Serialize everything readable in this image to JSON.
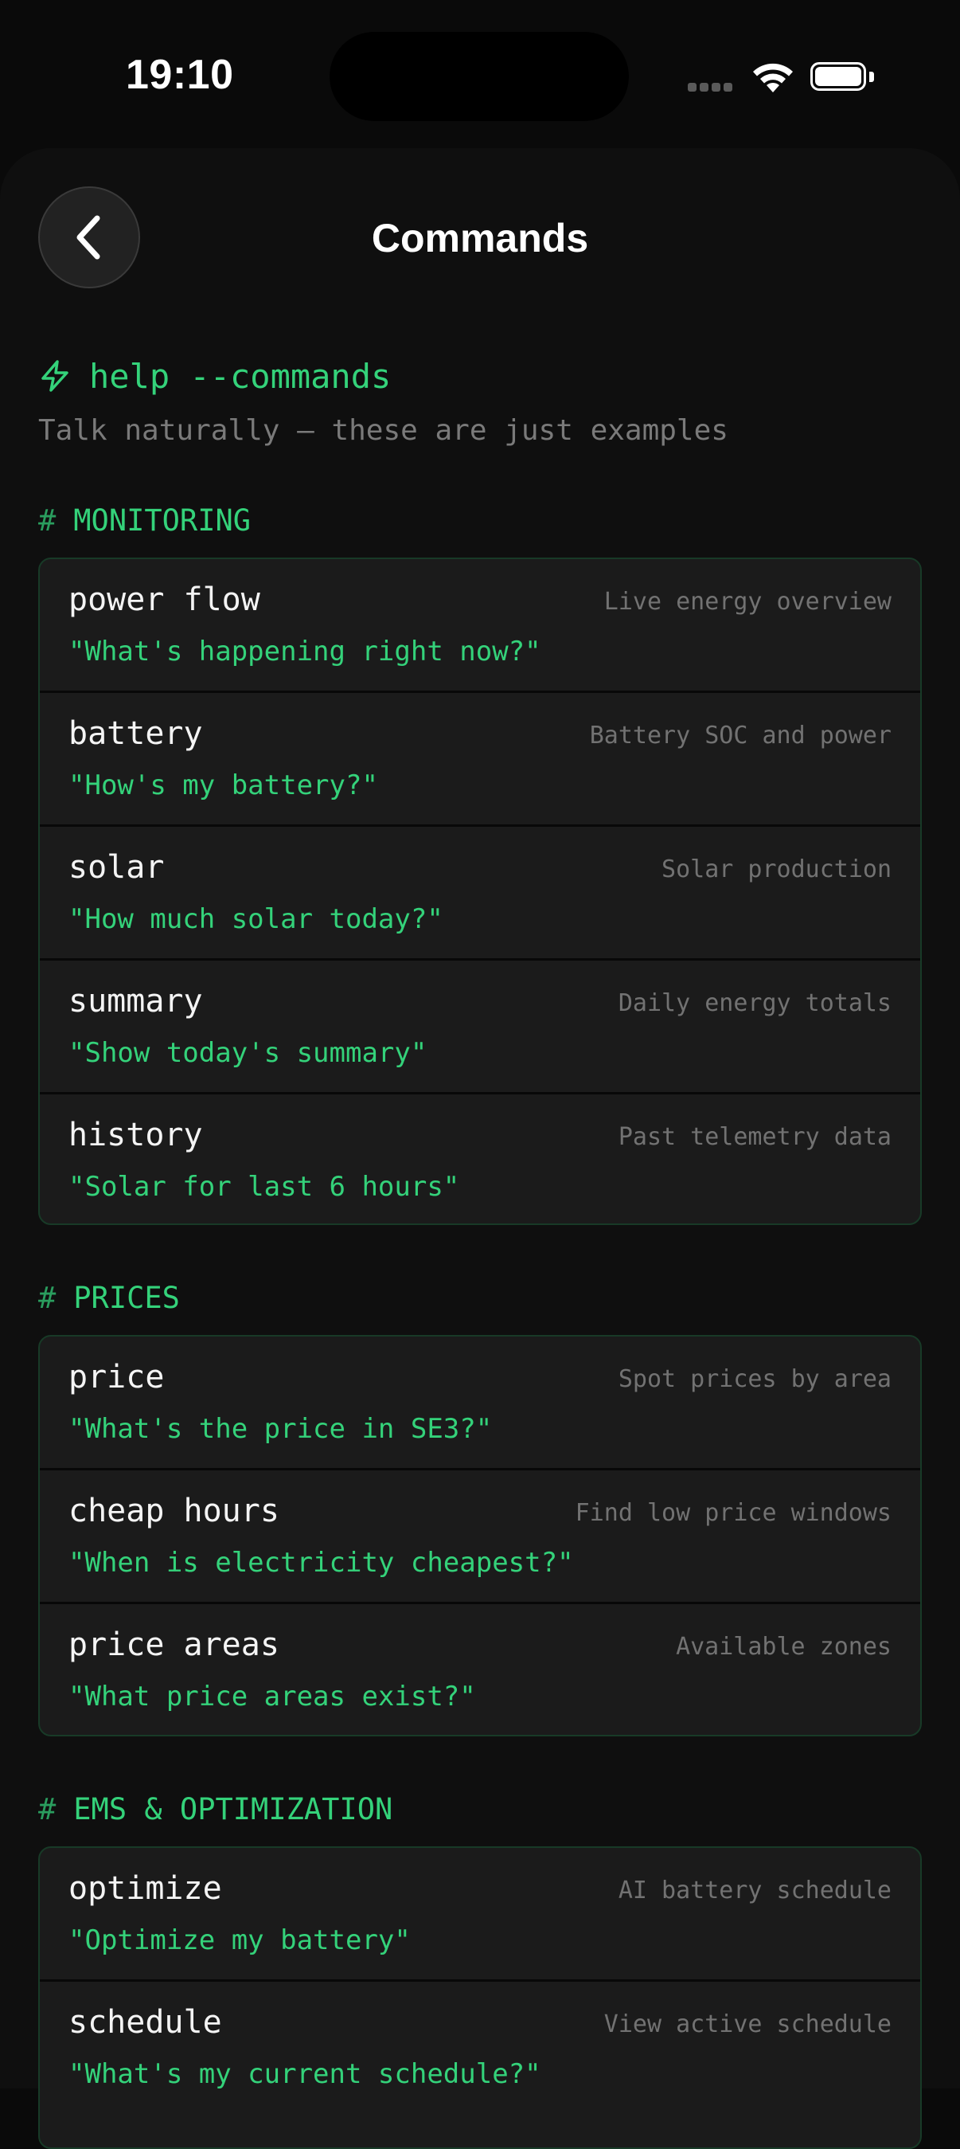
{
  "status_bar": {
    "time": "19:10"
  },
  "header": {
    "title": "Commands"
  },
  "intro": {
    "command": "help --commands",
    "subtitle": "Talk naturally — these are just examples"
  },
  "sections": [
    {
      "title": "MONITORING",
      "items": [
        {
          "command": "power flow",
          "description": "Live energy overview",
          "example": "\"What's happening right now?\""
        },
        {
          "command": "battery",
          "description": "Battery SOC and power",
          "example": "\"How's my battery?\""
        },
        {
          "command": "solar",
          "description": "Solar production",
          "example": "\"How much solar today?\""
        },
        {
          "command": "summary",
          "description": "Daily energy totals",
          "example": "\"Show today's summary\""
        },
        {
          "command": "history",
          "description": "Past telemetry data",
          "example": "\"Solar for last 6 hours\""
        }
      ]
    },
    {
      "title": "PRICES",
      "items": [
        {
          "command": "price",
          "description": "Spot prices by area",
          "example": "\"What's the price in SE3?\""
        },
        {
          "command": "cheap hours",
          "description": "Find low price windows",
          "example": "\"When is electricity cheapest?\""
        },
        {
          "command": "price areas",
          "description": "Available zones",
          "example": "\"What price areas exist?\""
        }
      ]
    },
    {
      "title": "EMS & OPTIMIZATION",
      "items": [
        {
          "command": "optimize",
          "description": "AI battery schedule",
          "example": "\"Optimize my battery\""
        },
        {
          "command": "schedule",
          "description": "View active schedule",
          "example": "\"What's my current schedule?\""
        }
      ]
    }
  ],
  "colors": {
    "accent": "#34d27a",
    "background": "#0a0a0a",
    "card": "#1b1b1b",
    "muted_text": "#727272"
  },
  "icons": {
    "back": "chevron-left-icon",
    "help": "bolt-icon"
  }
}
